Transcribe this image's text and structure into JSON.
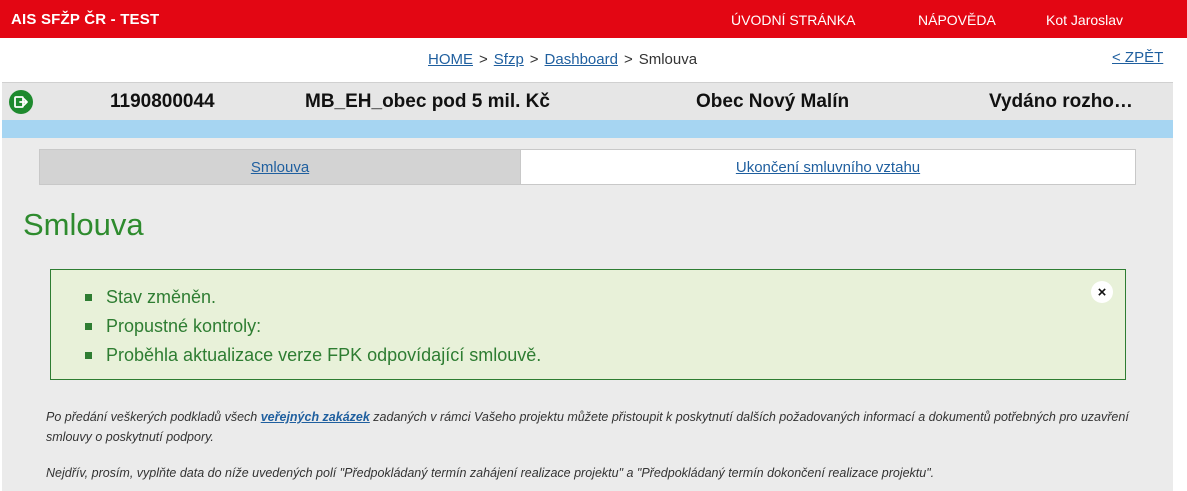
{
  "topbar": {
    "brand": "AIS SFŽP ČR - TEST",
    "nav_home": "ÚVODNÍ STRÁNKA",
    "nav_help": "NÁPOVĚDA",
    "user": "Kot Jaroslav"
  },
  "breadcrumb": {
    "items": [
      "HOME",
      "Sfzp",
      "Dashboard"
    ],
    "current": "Smlouva",
    "separator": ">",
    "back": "< ZPĚT"
  },
  "project": {
    "id": "1190800044",
    "name": "MB_EH_obec pod 5 mil. Kč",
    "organization": "Obec Nový Malín",
    "state": "Vydáno rozho…"
  },
  "tabs": [
    {
      "label": "Smlouva",
      "active": true
    },
    {
      "label": "Ukončení smluvního vztahu",
      "active": false
    }
  ],
  "page_title": "Smlouva",
  "alert": {
    "messages": [
      "Stav změněn.",
      "Propustné kontroly:",
      "Proběhla aktualizace verze FPK odpovídající smlouvě."
    ],
    "close": "×"
  },
  "info": {
    "p1_before": "Po předání veškerých podkladů všech ",
    "p1_link": "veřejných zakázek",
    "p1_after": " zadaných v rámci Vašeho projektu můžete přistoupit k poskytnutí dalších požadovaných informací a dokumentů potřebných pro uzavření smlouvy o poskytnutí podpory.",
    "p2": "Nejdřív, prosím, vyplňte data do níže uvedených polí \"Předpokládaný termín zahájení realizace projektu\" a \"Předpokládaný termín dokončení realizace projektu\"."
  },
  "colors": {
    "topbar": "#e30613",
    "success": "#2e7d32",
    "link": "#1f5f9f",
    "blue_bar": "#a6d5f2"
  }
}
